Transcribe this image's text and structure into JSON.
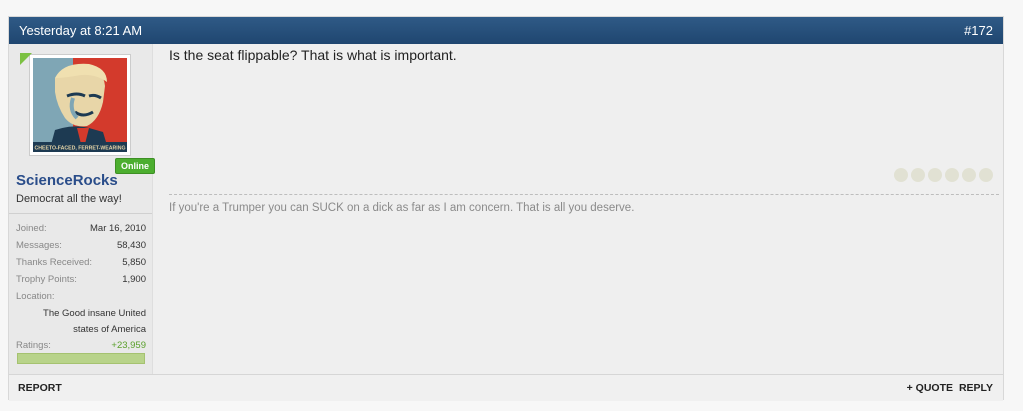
{
  "post": {
    "timestamp": "Yesterday at 8:21 AM",
    "number": "#172",
    "message": "Is the seat flippable? That is what is important.",
    "signature": "If you're a Trumper you can SUCK on a dick as far as I am concern. That is all you deserve."
  },
  "user": {
    "status": "Online",
    "name": "ScienceRocks",
    "title": "Democrat all the way!",
    "stats": {
      "joined_label": "Joined:",
      "joined": "Mar 16, 2010",
      "messages_label": "Messages:",
      "messages": "58,430",
      "thanks_label": "Thanks Received:",
      "thanks": "5,850",
      "trophy_label": "Trophy Points:",
      "trophy": "1,900",
      "location_label": "Location:",
      "location_1": "The Good insane United",
      "location_2": "states of America",
      "ratings_label": "Ratings:",
      "ratings": "+23,959"
    },
    "reputation_fill": 1.0,
    "avatar_caption": "CHEETO-FACED, FERRET-WEARING"
  },
  "footer": {
    "report": "REPORT",
    "quote": "+ QUOTE",
    "reply": "REPLY"
  },
  "colors": {
    "header": "#2f5a86",
    "username": "#2a4d8a",
    "online": "#4cae2f",
    "ratings": "#5aa02c"
  }
}
